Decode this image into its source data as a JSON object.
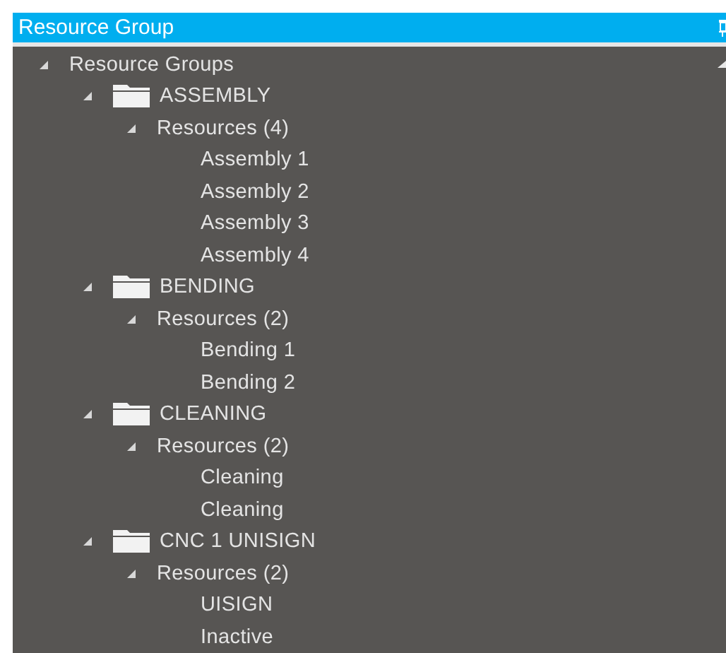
{
  "panel": {
    "title": "Resource Group"
  },
  "tree": [
    {
      "label": "Resource Groups",
      "kind": "root",
      "expanded": true,
      "children": [
        {
          "label": "ASSEMBLY",
          "kind": "group",
          "expanded": true,
          "children": [
            {
              "label": "Resources (4)",
              "kind": "resources",
              "expanded": true,
              "children": [
                {
                  "label": "Assembly 1",
                  "kind": "resource"
                },
                {
                  "label": "Assembly 2",
                  "kind": "resource"
                },
                {
                  "label": "Assembly 3",
                  "kind": "resource"
                },
                {
                  "label": "Assembly 4",
                  "kind": "resource"
                }
              ]
            }
          ]
        },
        {
          "label": "BENDING",
          "kind": "group",
          "expanded": true,
          "children": [
            {
              "label": "Resources (2)",
              "kind": "resources",
              "expanded": true,
              "children": [
                {
                  "label": "Bending 1",
                  "kind": "resource"
                },
                {
                  "label": "Bending 2",
                  "kind": "resource"
                }
              ]
            }
          ]
        },
        {
          "label": "CLEANING",
          "kind": "group",
          "expanded": true,
          "children": [
            {
              "label": "Resources (2)",
              "kind": "resources",
              "expanded": true,
              "children": [
                {
                  "label": "Cleaning",
                  "kind": "resource"
                },
                {
                  "label": "Cleaning",
                  "kind": "resource"
                }
              ]
            }
          ]
        },
        {
          "label": "CNC 1 UNISIGN",
          "kind": "group",
          "expanded": true,
          "children": [
            {
              "label": "Resources (2)",
              "kind": "resources",
              "expanded": true,
              "children": [
                {
                  "label": "UISIGN",
                  "kind": "resource"
                },
                {
                  "label": "Inactive",
                  "kind": "resource"
                }
              ]
            }
          ]
        }
      ]
    }
  ]
}
